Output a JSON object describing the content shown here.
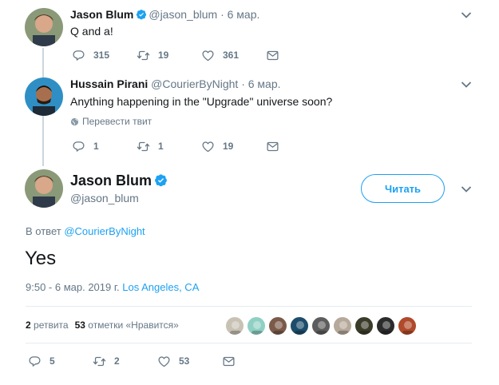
{
  "tweets": [
    {
      "name": "Jason Blum",
      "handle": "@jason_blum",
      "separator": "·",
      "time": "6 мар.",
      "text": "Q and a!",
      "replies": "315",
      "retweets": "19",
      "likes": "361",
      "avatar_color": "#7a8a6a"
    },
    {
      "name": "Hussain Pirani",
      "handle": "@CourierByNight",
      "separator": "·",
      "time": "6 мар.",
      "text": "Anything happening in the \"Upgrade\" universe soon?",
      "translate_label": "Перевести твит",
      "replies": "1",
      "retweets": "1",
      "likes": "19",
      "avatar_color": "#2a86b8"
    }
  ],
  "main_tweet": {
    "name": "Jason Blum",
    "handle": "@jason_blum",
    "follow_label": "Читать",
    "reply_prefix": "В ответ",
    "reply_to": "@CourierByNight",
    "text": "Yes",
    "timestamp": "9:50 - 6 мар. 2019 г.",
    "location": "Los Angeles, CA",
    "retweet_count": "2",
    "retweet_label": "ретвита",
    "like_count": "53",
    "like_label": "отметки «Нравится»",
    "replies": "5",
    "retweets": "2",
    "likes": "53",
    "liker_colors": [
      "#c8c2b4",
      "#8fd0c4",
      "#7b5a4a",
      "#1d4d6b",
      "#5d5d5d",
      "#b6a99a",
      "#3b3b2a",
      "#2b2b2b",
      "#b04a2a"
    ]
  },
  "colors": {
    "accent": "#1da1f2",
    "secondary_text": "#657786",
    "primary_text": "#14171a",
    "thread_line": "#ccd6dd"
  },
  "icons": [
    "verified-icon",
    "reply-icon",
    "retweet-icon",
    "like-icon",
    "message-icon",
    "chevron-down-icon",
    "globe-icon"
  ]
}
